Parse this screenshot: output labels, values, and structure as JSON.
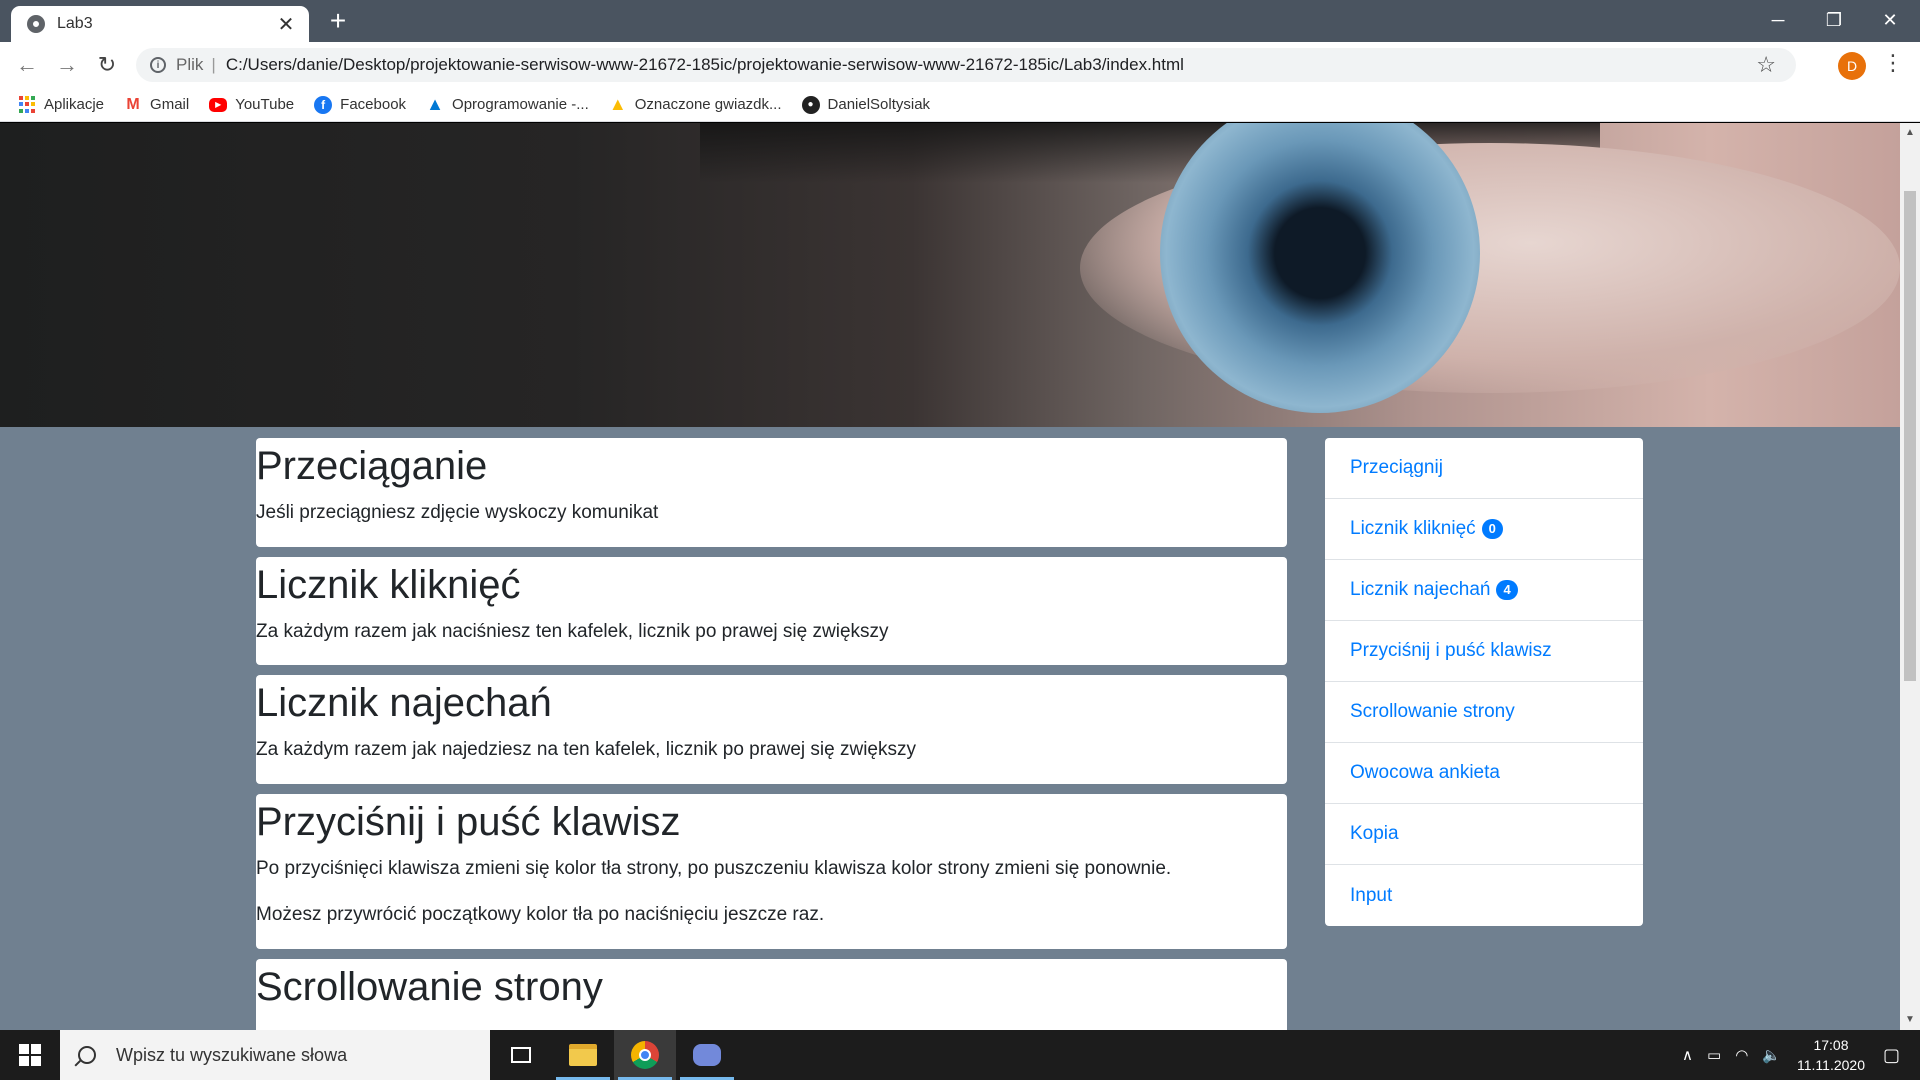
{
  "browser": {
    "tab_title": "Lab3",
    "address_scheme": "Plik",
    "address_url": "C:/Users/danie/Desktop/projektowanie-serwisow-www-21672-185ic/projektowanie-serwisow-www-21672-185ic/Lab3/index.html",
    "profile_initial": "D",
    "bookmarks": [
      {
        "label": "Aplikacje",
        "icon": "apps-grid-icon"
      },
      {
        "label": "Gmail",
        "icon": "gmail-icon"
      },
      {
        "label": "YouTube",
        "icon": "youtube-icon"
      },
      {
        "label": "Facebook",
        "icon": "facebook-icon"
      },
      {
        "label": "Oprogramowanie -...",
        "icon": "azure-icon"
      },
      {
        "label": "Oznaczone gwiazdk...",
        "icon": "google-drive-icon"
      },
      {
        "label": "DanielSoltysiak",
        "icon": "github-icon"
      }
    ]
  },
  "page": {
    "cards": [
      {
        "title": "Przeciąganie",
        "paragraphs": [
          "Jeśli przeciągniesz zdjęcie wyskoczy komunikat"
        ]
      },
      {
        "title": "Licznik kliknięć",
        "paragraphs": [
          "Za każdym razem jak naciśniesz ten kafelek, licznik po prawej się zwiększy"
        ]
      },
      {
        "title": "Licznik najechań",
        "paragraphs": [
          "Za każdym razem jak najedziesz na ten kafelek, licznik po prawej się zwiększy"
        ]
      },
      {
        "title": "Przyciśnij i puść klawisz",
        "paragraphs": [
          "Po przyciśnięci klawisza zmieni się kolor tła strony, po puszczeniu klawisza kolor strony zmieni się ponownie.",
          "Możesz przywrócić początkowy kolor tła po naciśnięciu jeszcze raz."
        ]
      },
      {
        "title": "Scrollowanie strony",
        "paragraphs": []
      }
    ],
    "sidebar": [
      {
        "label": "Przeciągnij",
        "badge": null
      },
      {
        "label": "Licznik kliknięć",
        "badge": "0"
      },
      {
        "label": "Licznik najechań",
        "badge": "4"
      },
      {
        "label": "Przyciśnij i puść klawisz",
        "badge": null
      },
      {
        "label": "Scrollowanie strony",
        "badge": null
      },
      {
        "label": "Owocowa ankieta",
        "badge": null
      },
      {
        "label": "Kopia",
        "badge": null
      },
      {
        "label": "Input",
        "badge": null
      }
    ],
    "colors": {
      "background": "#708090",
      "link": "#007bff"
    }
  },
  "taskbar": {
    "search_placeholder": "Wpisz tu wyszukiwane słowa",
    "time": "17:08",
    "date": "11.11.2020"
  }
}
